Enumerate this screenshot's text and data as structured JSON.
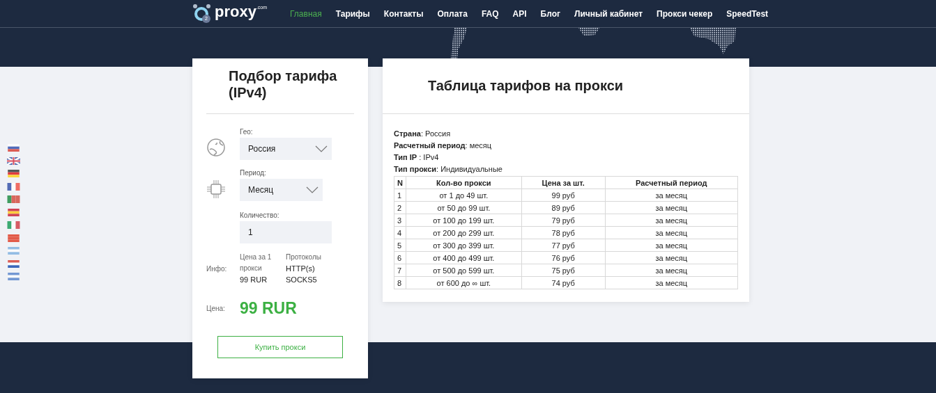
{
  "header": {
    "logo": {
      "name": "proxy",
      "suffix": ".com",
      "badge": "2"
    },
    "nav": [
      {
        "label": "Главная",
        "selected": true
      },
      {
        "label": "Тарифы",
        "selected": false
      },
      {
        "label": "Контакты",
        "selected": false
      },
      {
        "label": "Оплата",
        "selected": false
      },
      {
        "label": "FAQ",
        "selected": false
      },
      {
        "label": "API",
        "selected": false
      },
      {
        "label": "Блог",
        "selected": false
      },
      {
        "label": "Личный кабинет",
        "selected": false
      },
      {
        "label": "Прокси чекер",
        "selected": false
      },
      {
        "label": "SpeedTest",
        "selected": false
      }
    ]
  },
  "tariff_picker": {
    "title": "Подбор тарифа (IPv4)",
    "geo": {
      "label": "Гео:",
      "value": "Россия"
    },
    "period": {
      "label": "Период:",
      "value": "Месяц"
    },
    "quantity": {
      "label": "Количество:",
      "value": "1"
    },
    "info": {
      "label": "Инфо:",
      "price_label": "Цена за 1 прокси",
      "price": "99 RUR",
      "protocols_label": "Протоколы",
      "protocols": [
        "HTTP(s)",
        "SOCKS5"
      ]
    },
    "total": {
      "label": "Цена:",
      "value": "99 RUR"
    },
    "buy_button": "Купить прокси"
  },
  "tariff_table": {
    "title": "Таблица тарифов на прокси",
    "details": [
      "**Страна**: Россия",
      "**Расчетный период**: месяц",
      "**Тип IP** : IPv4",
      "**Тип прокси**: Индивидуальные"
    ],
    "columns": [
      "N",
      "Кол-во прокси",
      "Цена за шт.",
      "Расчетный период"
    ],
    "rows": [
      [
        "1",
        "от 1 до 49 шт.",
        "99 руб",
        "за месяц"
      ],
      [
        "2",
        "от 50 до 99 шт.",
        "89 руб",
        "за месяц"
      ],
      [
        "3",
        "от 100 до 199 шт.",
        "79 руб",
        "за месяц"
      ],
      [
        "4",
        "от 200 до 299 шт.",
        "78 руб",
        "за месяц"
      ],
      [
        "5",
        "от 300 до 399 шт.",
        "77 руб",
        "за месяц"
      ],
      [
        "6",
        "от 400 до 499 шт.",
        "76 руб",
        "за месяц"
      ],
      [
        "7",
        "от 500 до 599 шт.",
        "75 руб",
        "за месяц"
      ],
      [
        "8",
        "от 600 до ∞ шт.",
        "74 руб",
        "за месяц"
      ]
    ]
  }
}
